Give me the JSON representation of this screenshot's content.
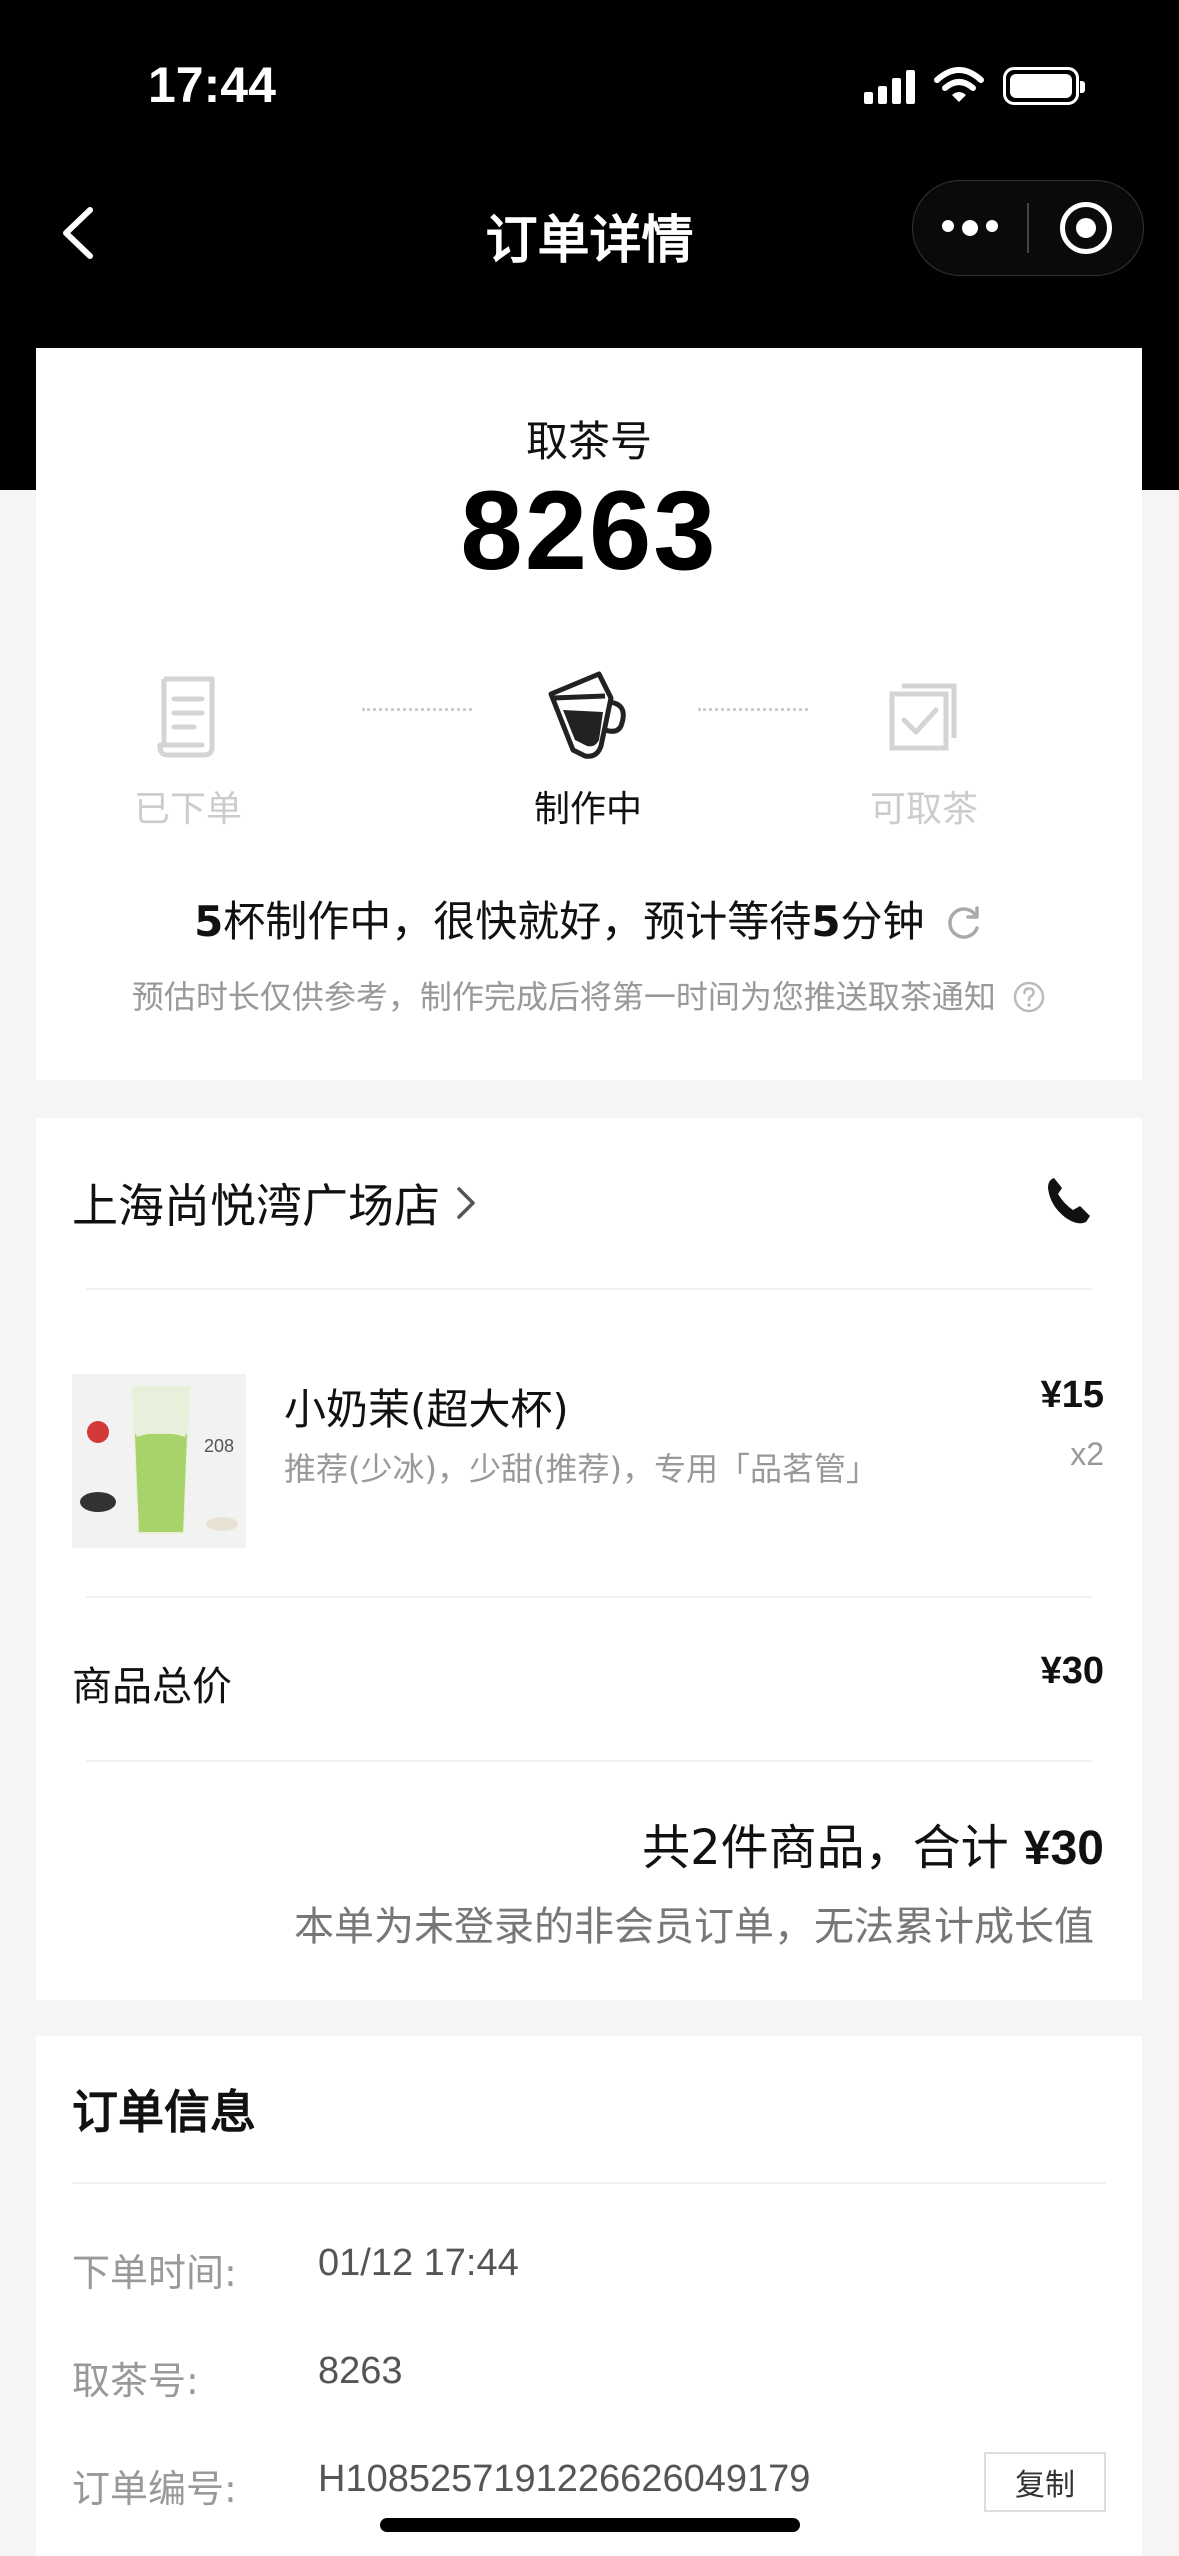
{
  "status_bar": {
    "time": "17:44"
  },
  "nav": {
    "title": "订单详情"
  },
  "pickup": {
    "label": "取茶号",
    "number": "8263",
    "steps": [
      {
        "label": "已下单",
        "state": "done"
      },
      {
        "label": "制作中",
        "state": "active"
      },
      {
        "label": "可取茶",
        "state": "pending"
      }
    ],
    "wait_count": "5",
    "wait_text_1": "杯制作中，很快就好，预计等待",
    "wait_minutes": "5",
    "wait_text_2": "分钟",
    "note": "预估时长仅供参考，制作完成后将第一时间为您推送取茶通知"
  },
  "store": {
    "name": "上海尚悦湾广场店"
  },
  "product": {
    "image_text": "208",
    "name": "小奶茉(超大杯)",
    "options": "推荐(少冰)，少甜(推荐)，专用「品茗管」",
    "price": "¥15",
    "quantity": "x2"
  },
  "summary": {
    "subtotal_label": "商品总价",
    "subtotal_value": "¥30",
    "total_prefix": "共2件商品，合计 ",
    "total_amount": "¥30",
    "member_note": "本单为未登录的非会员订单，无法累计成长值"
  },
  "order_info": {
    "title": "订单信息",
    "rows": [
      {
        "label": "下单时间:",
        "value": "01/12 17:44"
      },
      {
        "label": "取茶号:",
        "value": "8263"
      },
      {
        "label": "订单编号:",
        "value": "H1085257191226626049179"
      }
    ],
    "copy_label": "复制"
  },
  "colors": {
    "header_bg": "#000000",
    "page_bg": "#f5f5f5",
    "muted": "#999999"
  }
}
